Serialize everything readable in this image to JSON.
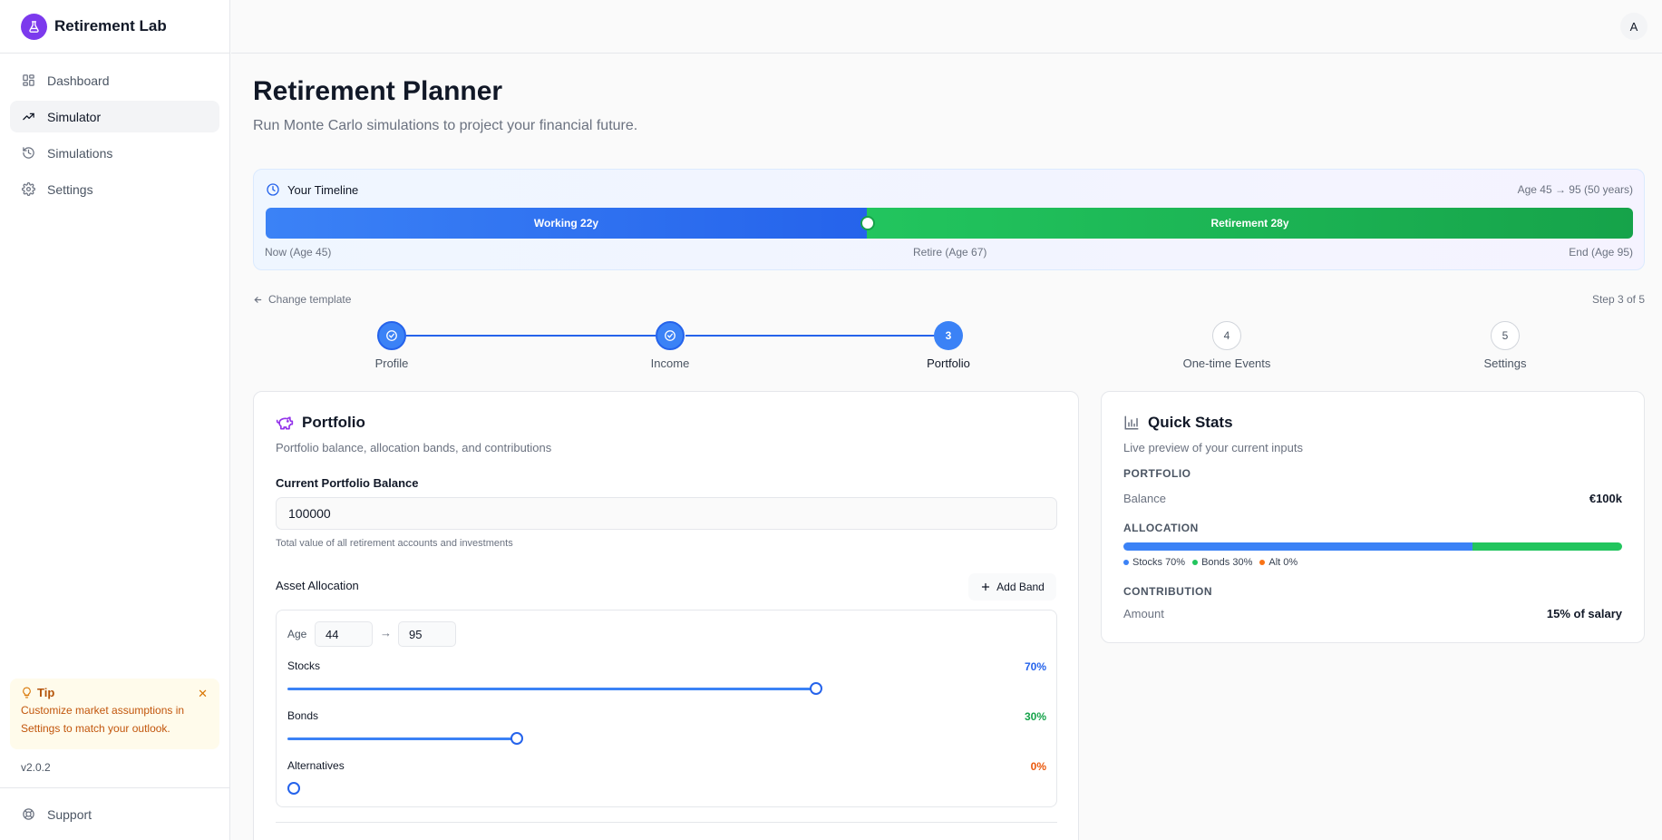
{
  "app": {
    "name": "Retirement Lab",
    "version": "v2.0.2",
    "avatar_initial": "A"
  },
  "sidebar": {
    "items": [
      {
        "label": "Dashboard",
        "icon": "dashboard-icon"
      },
      {
        "label": "Simulator",
        "icon": "trend-icon",
        "active": true
      },
      {
        "label": "Simulations",
        "icon": "history-icon"
      },
      {
        "label": "Settings",
        "icon": "gear-icon"
      }
    ],
    "tip": {
      "title": "Tip",
      "text": "Customize market assumptions in Settings to match your outlook."
    },
    "support": "Support"
  },
  "page": {
    "title": "Retirement Planner",
    "subtitle": "Run Monte Carlo simulations to project your financial future."
  },
  "timeline": {
    "title": "Your Timeline",
    "range": "Age 45 → 95 (50 years)",
    "working": "Working 22y",
    "retirement": "Retirement 28y",
    "working_fraction": 0.44,
    "now": "Now (Age 45)",
    "retire": "Retire (Age 67)",
    "end": "End (Age 95)"
  },
  "nav": {
    "back": "Change template",
    "step_count": "Step 3 of 5"
  },
  "steps": [
    {
      "label": "Profile",
      "status": "done",
      "number": "1"
    },
    {
      "label": "Income",
      "status": "done",
      "number": "2"
    },
    {
      "label": "Portfolio",
      "status": "current",
      "number": "3"
    },
    {
      "label": "One-time Events",
      "status": "todo",
      "number": "4"
    },
    {
      "label": "Settings",
      "status": "todo",
      "number": "5"
    }
  ],
  "portfolio": {
    "title": "Portfolio",
    "subtitle": "Portfolio balance, allocation bands, and contributions",
    "balance_label": "Current Portfolio Balance",
    "balance_value": "100000",
    "balance_help": "Total value of all retirement accounts and investments",
    "allocation_title": "Asset Allocation",
    "add_band": "Add Band",
    "band": {
      "age_label": "Age",
      "age_from": "44",
      "age_arrow": "→",
      "age_to": "95",
      "sliders": [
        {
          "label": "Stocks",
          "pct": "70%",
          "value": 0.7,
          "color": "#2563eb"
        },
        {
          "label": "Bonds",
          "pct": "30%",
          "value": 0.3,
          "color": "#16a34a"
        },
        {
          "label": "Alternatives",
          "pct": "0%",
          "value": 0.0,
          "color": "#ea580c"
        }
      ]
    }
  },
  "quick_stats": {
    "title": "Quick Stats",
    "subtitle": "Live preview of your current inputs",
    "portfolio_section": "PORTFOLIO",
    "balance_label": "Balance",
    "balance_value": "€100k",
    "allocation_section": "ALLOCATION",
    "allocation": [
      {
        "label": "Stocks 70%",
        "value": 70,
        "color": "#3b82f6"
      },
      {
        "label": "Bonds 30%",
        "value": 30,
        "color": "#22c55e"
      },
      {
        "label": "Alt 0%",
        "value": 0,
        "color": "#f97316"
      }
    ],
    "contribution_section": "CONTRIBUTION",
    "amount_label": "Amount",
    "amount_value": "15% of salary"
  }
}
